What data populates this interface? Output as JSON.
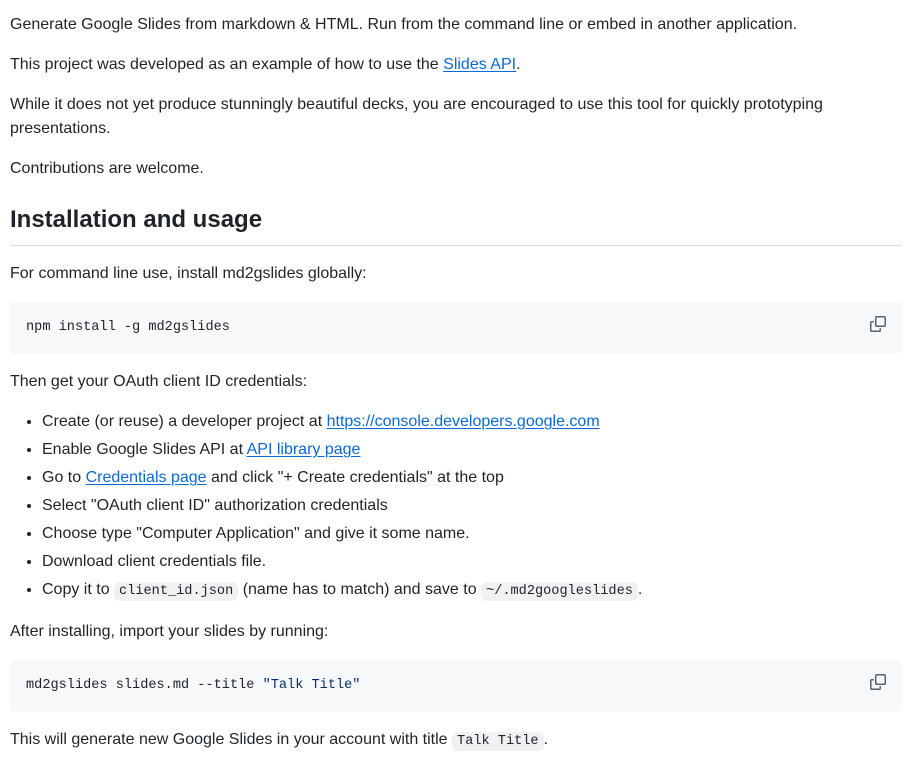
{
  "intro": {
    "p1": "Generate Google Slides from markdown & HTML. Run from the command line or embed in another application.",
    "p2_before": "This project was developed as an example of how to use the ",
    "p2_link": "Slides API",
    "p2_after": ".",
    "p3": "While it does not yet produce stunningly beautiful decks, you are encouraged to use this tool for quickly prototyping presentations.",
    "p4": "Contributions are welcome."
  },
  "install": {
    "heading": "Installation and usage",
    "p1": "For command line use, install md2gslides globally:",
    "code1": "npm install -g md2gslides",
    "p2": "Then get your OAuth client ID credentials:",
    "steps": [
      {
        "before": "Create (or reuse) a developer project at ",
        "link": "https://console.developers.google.com"
      },
      {
        "before": "Enable Google Slides API at ",
        "link": "API library page"
      },
      {
        "before": "Go to ",
        "link": "Credentials page",
        "after": " and click \"+ Create credentials\" at the top"
      },
      {
        "text": "Select \"OAuth client ID\" authorization credentials"
      },
      {
        "text": "Choose type \"Computer Application\" and give it some name."
      },
      {
        "text": "Download client credentials file."
      },
      {
        "before": "Copy it to ",
        "code1": "client_id.json",
        "middle": " (name has to match) and save to ",
        "code2": "~/.md2googleslides",
        "after": "."
      }
    ],
    "p3": "After installing, import your slides by running:",
    "code2_cmd": "md2gslides slides.md --title ",
    "code2_str": "\"Talk Title\"",
    "p4_before": "This will generate new Google Slides in your account with title ",
    "p4_code": "Talk Title",
    "p4_after": "."
  },
  "icons": {
    "copy": "copy-icon"
  },
  "colors": {
    "link": "#0969da",
    "code_bg": "#f6f8fa",
    "text": "#1f2328"
  }
}
